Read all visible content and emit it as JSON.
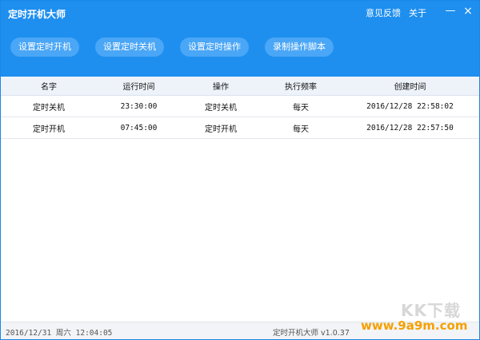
{
  "app": {
    "title": "定时开机大师",
    "links": [
      "意见反馈",
      "关于"
    ],
    "controls": {
      "minimize": "—",
      "close": "×"
    }
  },
  "actions": [
    "设置定时开机",
    "设置定时关机",
    "设置定时操作",
    "录制操作脚本"
  ],
  "table": {
    "headers": [
      "名字",
      "运行时间",
      "操作",
      "执行频率",
      "创建时间"
    ],
    "rows": [
      [
        "定时关机",
        "23:30:00",
        "定时关机",
        "每天",
        "2016/12/28 22:58:02"
      ],
      [
        "定时开机",
        "07:45:00",
        "定时开机",
        "每天",
        "2016/12/28 22:57:50"
      ]
    ]
  },
  "status": {
    "datetime": "2016/12/31 周六 12:04:05",
    "version": "定时开机大师 v1.0.37"
  },
  "watermark": {
    "logo": "KK下载",
    "site": "www.9a9m.com"
  }
}
